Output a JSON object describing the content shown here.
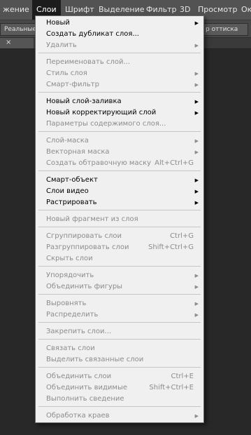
{
  "menubar": {
    "items": [
      "жение",
      "Слои",
      "Шрифт",
      "Выделение",
      "Фильтр",
      "3D",
      "Просмотр",
      "Ок"
    ]
  },
  "optionsbar": {
    "left_label": "Реальные",
    "right_label": "р оттиска"
  },
  "tabstrip": {
    "close_glyph": "×"
  },
  "menu": {
    "items": [
      {
        "label": "Новый",
        "shortcut": "",
        "submenu": true,
        "enabled": true
      },
      {
        "label": "Создать дубликат слоя...",
        "shortcut": "",
        "submenu": false,
        "enabled": true
      },
      {
        "label": "Удалить",
        "shortcut": "",
        "submenu": true,
        "enabled": false
      },
      {
        "label": "Переименовать слой...",
        "shortcut": "",
        "submenu": false,
        "enabled": false
      },
      {
        "label": "Стиль слоя",
        "shortcut": "",
        "submenu": true,
        "enabled": false
      },
      {
        "label": "Смарт-фильтр",
        "shortcut": "",
        "submenu": true,
        "enabled": false
      },
      {
        "label": "Новый слой-заливка",
        "shortcut": "",
        "submenu": true,
        "enabled": true
      },
      {
        "label": "Новый корректирующий слой",
        "shortcut": "",
        "submenu": true,
        "enabled": true
      },
      {
        "label": "Параметры содержимого слоя...",
        "shortcut": "",
        "submenu": false,
        "enabled": false
      },
      {
        "label": "Слой-маска",
        "shortcut": "",
        "submenu": true,
        "enabled": false
      },
      {
        "label": "Векторная маска",
        "shortcut": "",
        "submenu": true,
        "enabled": false
      },
      {
        "label": "Создать обтравочную маску",
        "shortcut": "Alt+Ctrl+G",
        "submenu": false,
        "enabled": false
      },
      {
        "label": "Смарт-объект",
        "shortcut": "",
        "submenu": true,
        "enabled": true
      },
      {
        "label": "Слои видео",
        "shortcut": "",
        "submenu": true,
        "enabled": true
      },
      {
        "label": "Растрировать",
        "shortcut": "",
        "submenu": true,
        "enabled": true
      },
      {
        "label": "Новый фрагмент из слоя",
        "shortcut": "",
        "submenu": false,
        "enabled": false
      },
      {
        "label": "Сгруппировать слои",
        "shortcut": "Ctrl+G",
        "submenu": false,
        "enabled": false
      },
      {
        "label": "Разгруппировать слои",
        "shortcut": "Shift+Ctrl+G",
        "submenu": false,
        "enabled": false
      },
      {
        "label": "Скрыть слои",
        "shortcut": "",
        "submenu": false,
        "enabled": false
      },
      {
        "label": "Упорядочить",
        "shortcut": "",
        "submenu": true,
        "enabled": false
      },
      {
        "label": "Объединить фигуры",
        "shortcut": "",
        "submenu": true,
        "enabled": false
      },
      {
        "label": "Выровнять",
        "shortcut": "",
        "submenu": true,
        "enabled": false
      },
      {
        "label": "Распределить",
        "shortcut": "",
        "submenu": true,
        "enabled": false
      },
      {
        "label": "Закрепить слои...",
        "shortcut": "",
        "submenu": false,
        "enabled": false
      },
      {
        "label": "Связать слои",
        "shortcut": "",
        "submenu": false,
        "enabled": false
      },
      {
        "label": "Выделить связанные слои",
        "shortcut": "",
        "submenu": false,
        "enabled": false
      },
      {
        "label": "Объединить слои",
        "shortcut": "Ctrl+E",
        "submenu": false,
        "enabled": false
      },
      {
        "label": "Объединить видимые",
        "shortcut": "Shift+Ctrl+E",
        "submenu": false,
        "enabled": false
      },
      {
        "label": "Выполнить сведение",
        "shortcut": "",
        "submenu": false,
        "enabled": false
      },
      {
        "label": "Обработка краев",
        "shortcut": "",
        "submenu": true,
        "enabled": false
      }
    ]
  }
}
